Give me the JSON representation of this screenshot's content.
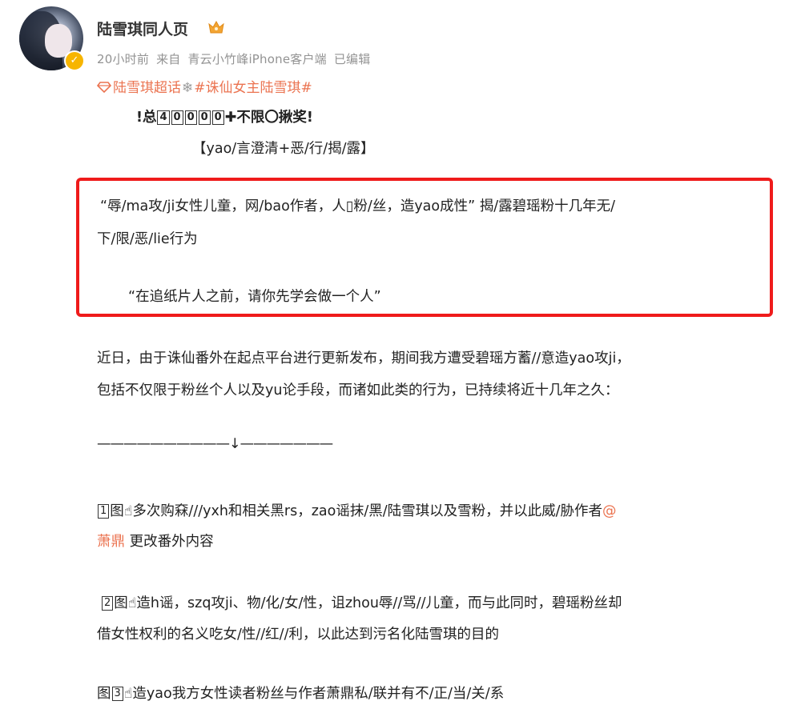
{
  "author": {
    "name": "陆雪琪同人页",
    "verified": true,
    "meta": {
      "time": "20小时前",
      "from": "来自",
      "source": "青云小竹峰iPhone客户端",
      "edited": "已编辑"
    }
  },
  "topics": {
    "supertopic": "陆雪琪超话",
    "separator": "❄",
    "hashtag": "#诛仙女主陆雪琪#"
  },
  "post": {
    "prize": {
      "prefix": "!总",
      "digits": [
        "4",
        "0",
        "0",
        "0",
        "0"
      ],
      "suffix": "✚不限〇揪奖!"
    },
    "bracket_title": "【yao/言澄清+恶/行/揭/露】",
    "quote_line1": "“辱/ma攻/ji女性儿童，网/bao作者，人▯粉/丝，造yao成性” 揭/露碧瑶粉十几年无/",
    "quote_line2": "下/限/恶/lie行为",
    "quote_line3": "“在追纸片人之前，请你先学会做一个人”",
    "para1_line1": "近日，由于诛仙番外在起点平台进行更新发布，期间我方遭受碧瑶方蓄//意造yao攻ji，",
    "para1_line2": "包括不仅限于粉丝个人以及yu论手段，而诸如此类的行为，已持续将近十几年之久：",
    "divider": "——————————↓———————",
    "item1": {
      "num": "1",
      "text_a": "图☝多次购㚞///yxh和相关黑rs，zao谣抹/黑/陆雪琪以及雪粉，并以此威/胁作者",
      "mention_a": "@",
      "mention_b": "萧鼎",
      "text_b": "更改番外内容"
    },
    "item2": {
      "num": "2",
      "text_a": "图☝造h谣，szq攻ji、物/化/女/性，诅zhou辱//骂//儿童，而与此同时，碧瑶粉丝却",
      "text_b": "借女性权利的名义吃女/性//红//利，以此达到污名化陆雪琪的目的"
    },
    "item3": {
      "num": "3",
      "prefix": "图",
      "text": "☝造yao我方女性读者粉丝与作者萧鼎私/联并有不/正/当/关/系"
    }
  },
  "colors": {
    "accent": "#eb7350",
    "highlight_border": "#ef1b1b",
    "meta_text": "#939393",
    "verified": "#f7b500"
  }
}
